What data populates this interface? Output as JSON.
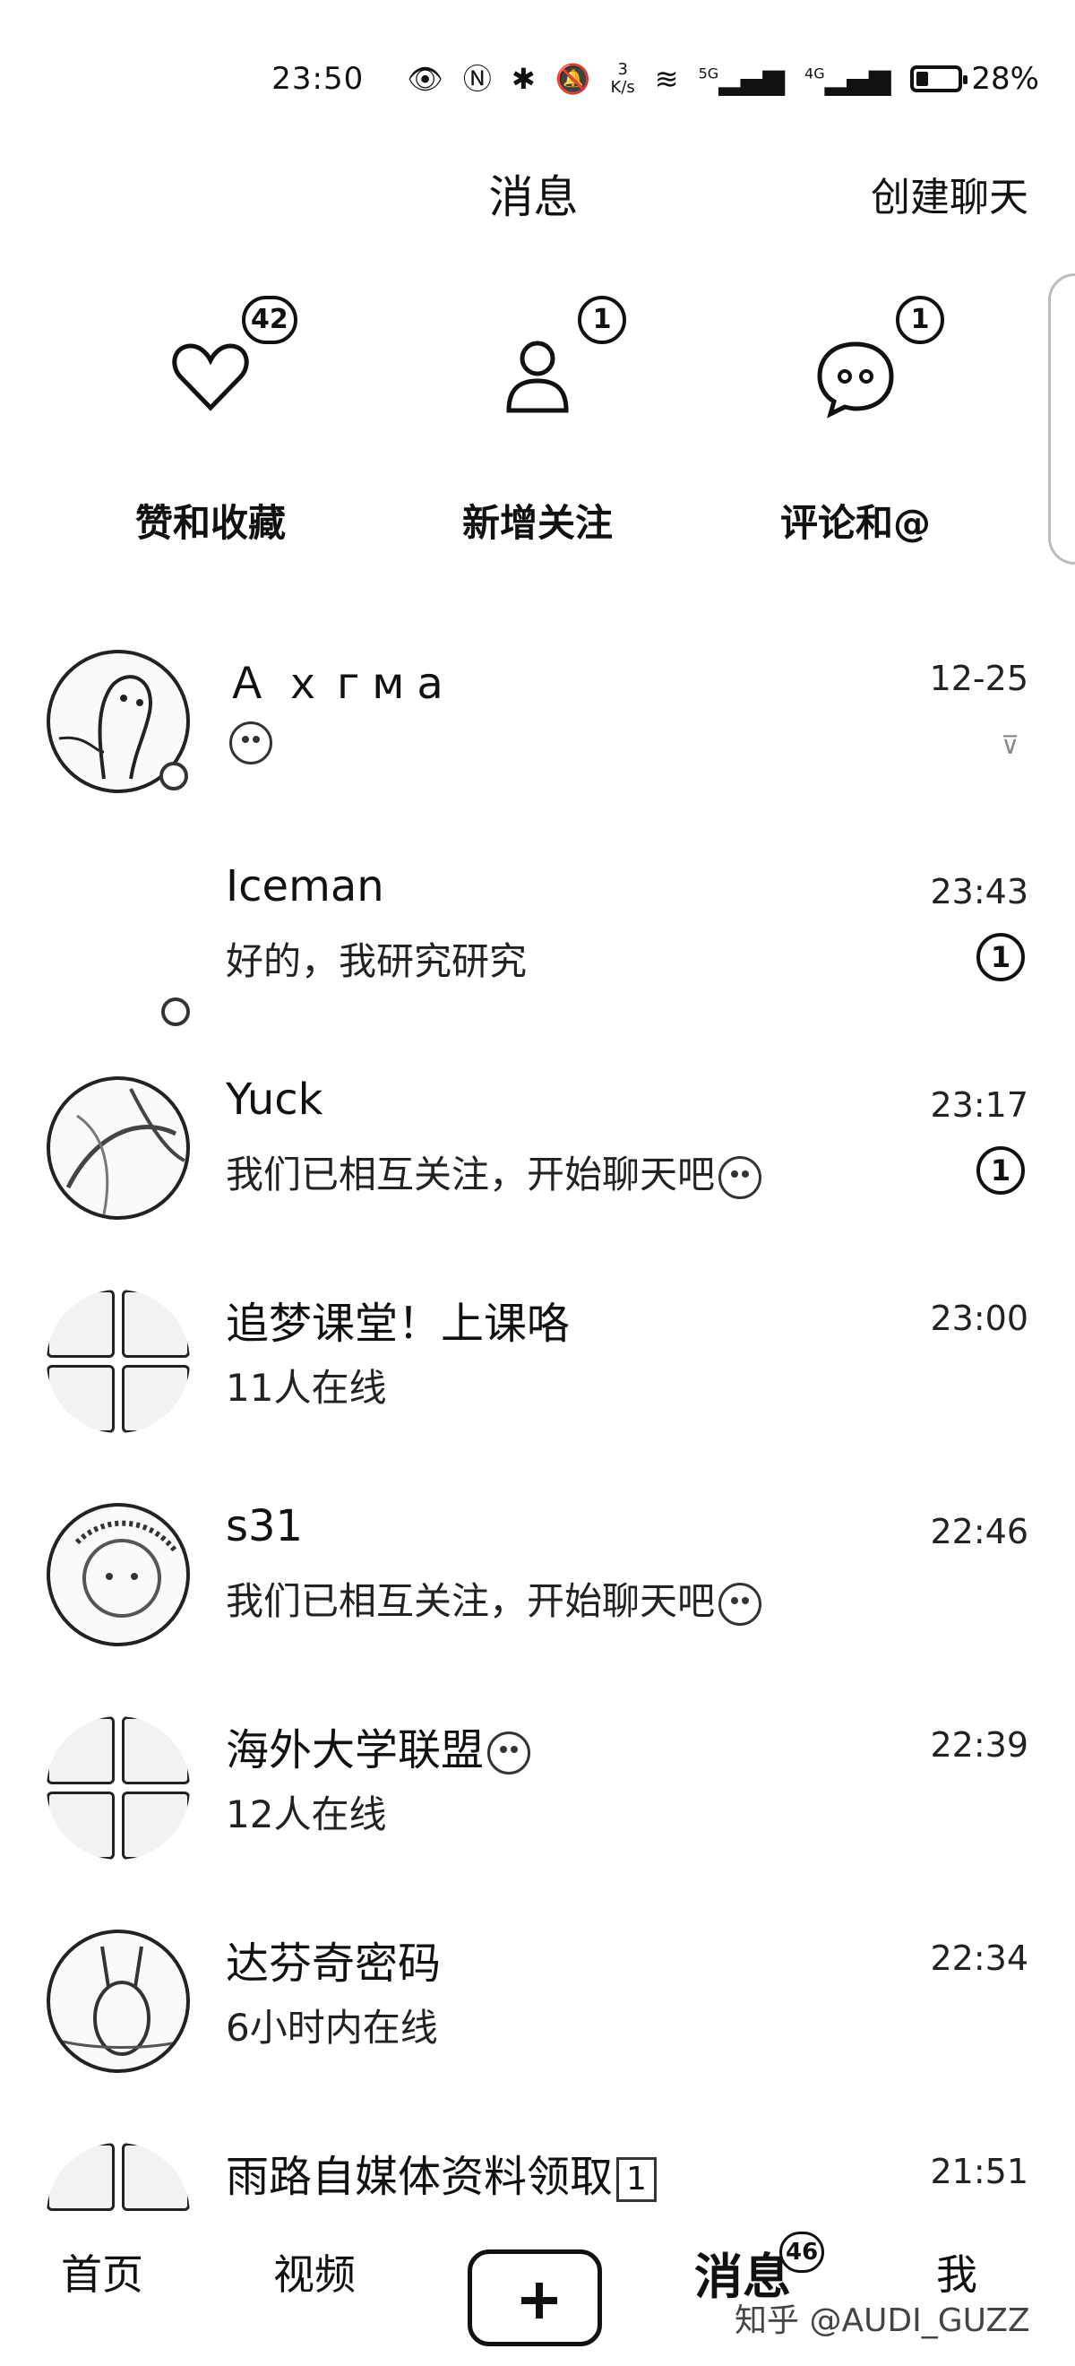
{
  "status_bar": {
    "time": "23:50",
    "net_speed_value": "3",
    "net_speed_unit": "K/s",
    "signal1_label": "5G",
    "signal2_label": "4G",
    "battery_percent": "28%",
    "battery_level": 0.28
  },
  "header": {
    "title": "消息",
    "create_chat": "创建聊天"
  },
  "notifications": [
    {
      "label": "赞和收藏",
      "badge": "42",
      "icon": "heart-icon"
    },
    {
      "label": "新增关注",
      "badge": "1",
      "icon": "person-icon"
    },
    {
      "label": "评论和@",
      "badge": "1",
      "icon": "chat-bubble-icon"
    }
  ],
  "chats": [
    {
      "name": "Ａｘгма",
      "preview": "",
      "time": "12-25",
      "unread": "",
      "muted": "⊽",
      "avatar": "cartoon",
      "online": true
    },
    {
      "name": "Iceman",
      "preview": "好的，我研究研究",
      "time": "23:43",
      "unread": "1",
      "avatar": "none",
      "online": true
    },
    {
      "name": "Yuck",
      "preview": "我们已相互关注，开始聊天吧",
      "time": "23:17",
      "unread": "1",
      "avatar": "photo",
      "online": false
    },
    {
      "name": "追梦课堂！上课咯",
      "preview": "11人在线",
      "time": "23:00",
      "unread": "",
      "avatar": "group",
      "online": false
    },
    {
      "name": "s31",
      "preview": "我们已相互关注，开始聊天吧",
      "time": "22:46",
      "unread": "",
      "avatar": "photo",
      "online": false
    },
    {
      "name": "海外大学联盟",
      "preview": "12人在线",
      "time": "22:39",
      "unread": "",
      "avatar": "group",
      "online": false
    },
    {
      "name": "达芬奇密码",
      "preview": "6小时内在线",
      "time": "22:34",
      "unread": "",
      "avatar": "photo",
      "online": false
    },
    {
      "name": "雨路自媒体资料领取",
      "name_suffix": "1",
      "preview": "",
      "time": "21:51",
      "unread": "",
      "avatar": "group",
      "online": false
    }
  ],
  "bottom_nav": {
    "home": "首页",
    "video": "视频",
    "messages": "消息",
    "messages_badge": "46",
    "me": "我"
  },
  "watermark": "知乎 @AUDI_GUZZ"
}
